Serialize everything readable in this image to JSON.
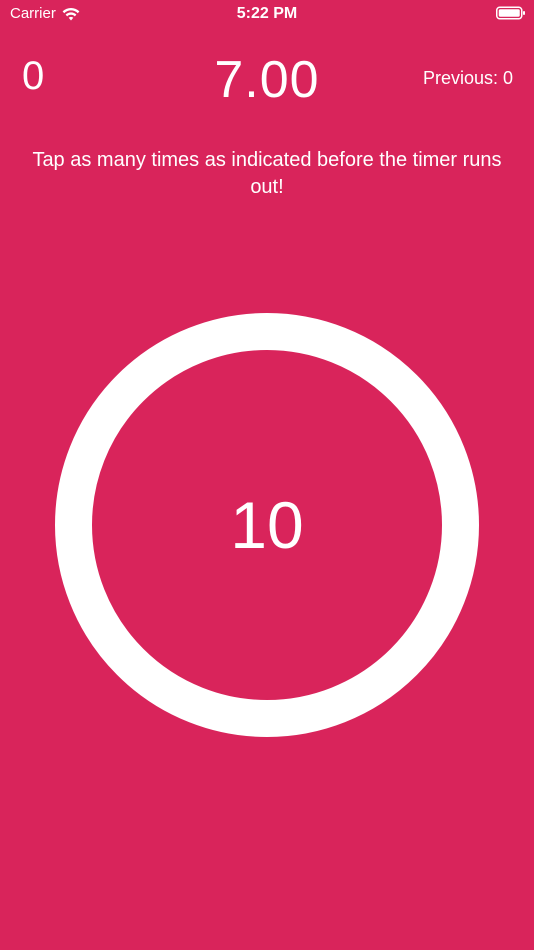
{
  "status_bar": {
    "carrier": "Carrier",
    "time": "5:22 PM"
  },
  "game": {
    "score": "0",
    "timer": "7.00",
    "previous": "Previous: 0",
    "instructions": "Tap as many times as indicated before the timer runs out!",
    "taps_remaining": "10"
  },
  "colors": {
    "background": "#D9245B",
    "foreground": "#FFFFFF"
  },
  "icons": {
    "wifi": "wifi-icon",
    "battery": "battery-icon"
  }
}
